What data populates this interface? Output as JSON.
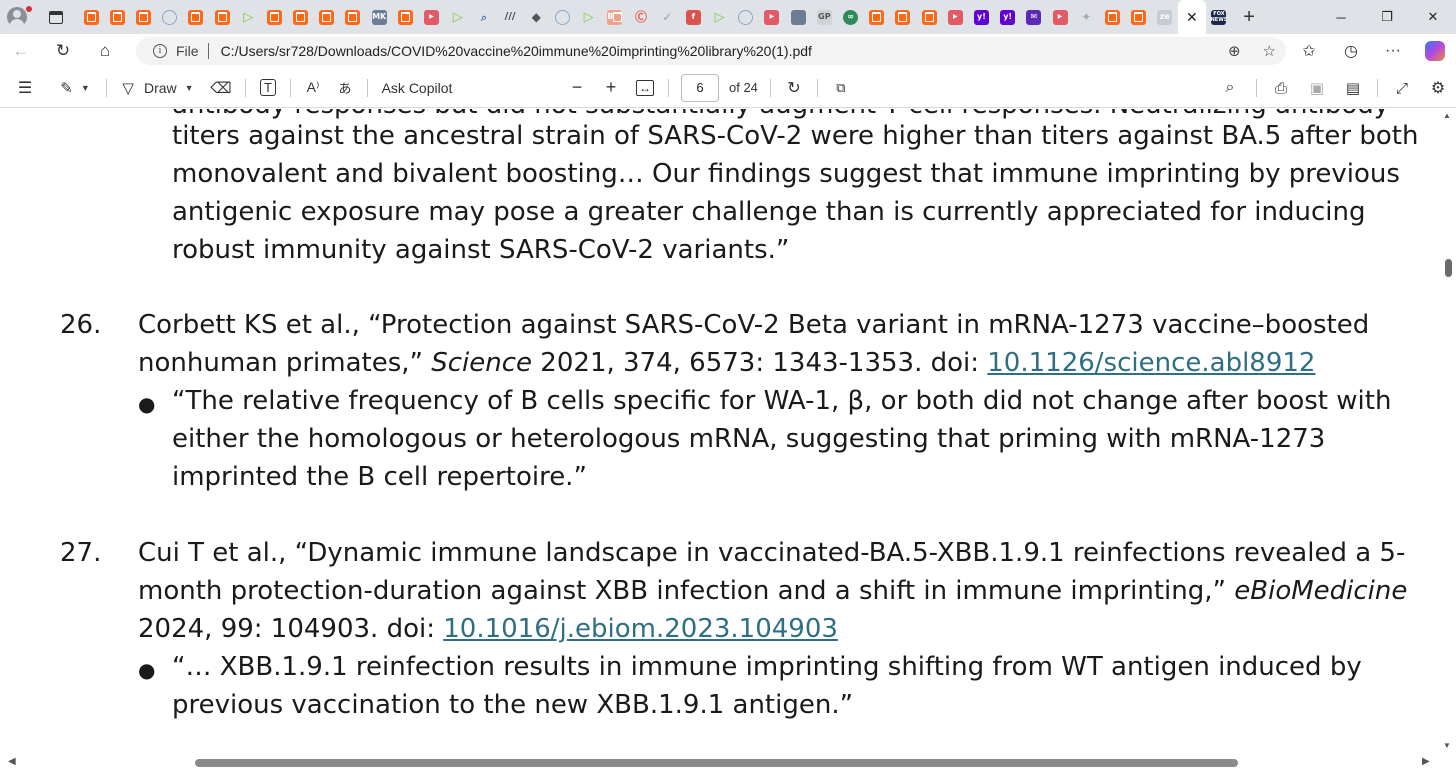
{
  "browser": {
    "active_tab_close": "✕",
    "new_tab": "+",
    "window_controls": {
      "minimize": "─",
      "restore": "❐",
      "close": "✕"
    },
    "tabs": [
      {
        "icon": "substack-icon",
        "label": ""
      },
      {
        "icon": "substack-icon",
        "label": ""
      },
      {
        "icon": "substack-icon",
        "label": ""
      },
      {
        "icon": "globe-icon",
        "label": ""
      },
      {
        "icon": "substack-icon",
        "label": ""
      },
      {
        "icon": "substack-icon",
        "label": ""
      },
      {
        "icon": "rumble-icon",
        "label": ""
      },
      {
        "icon": "substack-icon",
        "label": ""
      },
      {
        "icon": "substack-icon",
        "label": ""
      },
      {
        "icon": "substack-icon",
        "label": ""
      },
      {
        "icon": "substack-icon",
        "label": ""
      },
      {
        "icon": "news-icon",
        "label": "MK"
      },
      {
        "icon": "substack-icon",
        "label": ""
      },
      {
        "icon": "youtube-icon",
        "label": ""
      },
      {
        "icon": "rumble-icon",
        "label": ""
      },
      {
        "icon": "search-icon",
        "label": ""
      },
      {
        "icon": "site-icon",
        "label": "///"
      },
      {
        "icon": "diamond-icon",
        "label": ""
      },
      {
        "icon": "globe-icon",
        "label": ""
      },
      {
        "icon": "rumble-icon",
        "label": ""
      },
      {
        "icon": "letter-icon",
        "label": "B"
      },
      {
        "icon": "cyclone-icon",
        "label": ""
      },
      {
        "icon": "check-icon",
        "label": ""
      },
      {
        "icon": "red-square-icon",
        "label": "f"
      },
      {
        "icon": "rumble-icon",
        "label": ""
      },
      {
        "icon": "globe-icon",
        "label": ""
      },
      {
        "icon": "youtube-icon",
        "label": ""
      },
      {
        "icon": "news-icon",
        "label": ""
      },
      {
        "icon": "gp-icon",
        "label": "GP"
      },
      {
        "icon": "green-icon",
        "label": "∞"
      },
      {
        "icon": "substack-icon",
        "label": ""
      },
      {
        "icon": "substack-icon",
        "label": ""
      },
      {
        "icon": "substack-icon",
        "label": ""
      },
      {
        "icon": "youtube-icon",
        "label": ""
      },
      {
        "icon": "yahoo-icon",
        "label": "y!"
      },
      {
        "icon": "yahoo-icon",
        "label": "y!"
      },
      {
        "icon": "mail-icon",
        "label": "✉"
      },
      {
        "icon": "youtube-icon",
        "label": ""
      },
      {
        "icon": "sparkle-icon",
        "label": ""
      },
      {
        "icon": "substack-icon",
        "label": ""
      },
      {
        "icon": "substack-icon",
        "label": ""
      },
      {
        "icon": "ze-icon",
        "label": "ze"
      }
    ],
    "after_active_tab": {
      "icon": "fox-news-icon",
      "label": "FOX NEWS"
    },
    "address": {
      "file_label": "File",
      "url": "C:/Users/sr728/Downloads/COVID%20vaccine%20immune%20imprinting%20library%20(1).pdf"
    }
  },
  "pdf_toolbar": {
    "draw_label": "Draw",
    "ask_copilot_label": "Ask Copilot",
    "page_current": "6",
    "page_total": "of 24",
    "zoom_out": "−",
    "zoom_in": "+"
  },
  "document": {
    "cut_line": "antibody responses but did not substantially augment T cell responses. Neutralizing antibody",
    "intro_lines": [
      "titers against the ancestral strain of SARS-CoV-2 were higher than titers against BA.5 after both",
      "monovalent and bivalent boosting… Our findings suggest that immune imprinting by previous",
      "antigenic exposure may pose a greater challenge than is currently appreciated for inducing",
      "robust immunity against SARS-CoV-2 variants.”"
    ],
    "references": [
      {
        "number": "26.",
        "line1": "Corbett KS et al., “Protection against SARS-CoV-2 Beta variant in mRNA-1273 vaccine–boosted",
        "line2_pre": "nonhuman primates,” ",
        "line2_journal": "Science",
        "line2_post": " 2021, 374, 6573: 1343-1353. doi: ",
        "doi": "10.1126/science.abl8912",
        "bullet": "●",
        "quote_lines": [
          "“The relative frequency of B cells specific for WA-1, β, or both did not change after boost with",
          "either the homologous or heterologous mRNA, suggesting that priming with mRNA-1273",
          "imprinted the B cell repertoire.”"
        ]
      },
      {
        "number": "27.",
        "line1": "Cui T et al., “Dynamic immune landscape in vaccinated-BA.5-XBB.1.9.1 reinfections revealed a 5-",
        "line2_pre": "month protection-duration against XBB infection and a shift in immune imprinting,” ",
        "line2_journal": "eBioMedicine",
        "line3_pre": "2024, 99: 104903. doi: ",
        "doi": "10.1016/j.ebiom.2023.104903",
        "bullet": "●",
        "quote_lines": [
          "“… XBB.1.9.1 reinfection results in immune imprinting shifting from WT antigen induced by",
          "previous vaccination to the new XBB.1.9.1 antigen.”"
        ]
      }
    ]
  },
  "colors": {
    "link": "#2f6f83",
    "tabstrip": "#dfe3e8",
    "substack": "#ff6719"
  }
}
